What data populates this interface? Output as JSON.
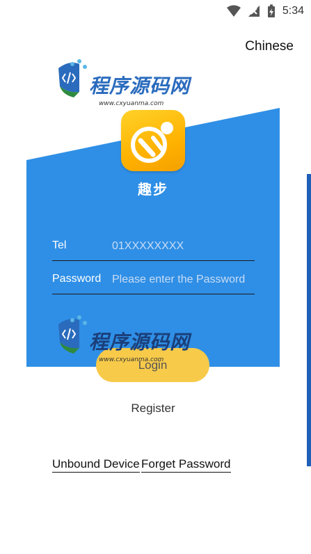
{
  "status_bar": {
    "time": "5:34",
    "icons": [
      "wifi-icon",
      "signal-icon",
      "battery-icon"
    ]
  },
  "header": {
    "language": "Chinese"
  },
  "app": {
    "name": "趣步"
  },
  "form": {
    "tel": {
      "label": "Tel",
      "placeholder": "01XXXXXXXX"
    },
    "password": {
      "label": "Password",
      "placeholder": "Please enter the Password"
    }
  },
  "actions": {
    "login": "Login",
    "register": "Register",
    "unbound_device": "Unbound Device",
    "forget_password": "Forget Password"
  },
  "watermark": {
    "text": "程序源码网",
    "url": "www.cxyuanma.com"
  },
  "colors": {
    "panel_blue": "#2f8fe6",
    "button_yellow": "#f7ca4a",
    "logo_orange": "#ffb200"
  }
}
